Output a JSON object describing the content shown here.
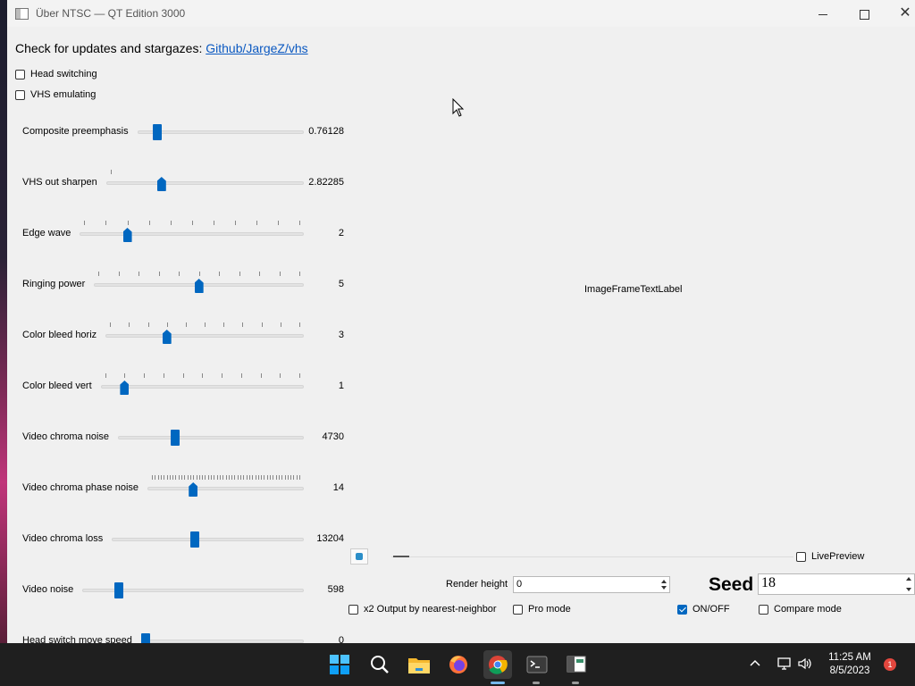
{
  "window": {
    "title": "Über NTSC — QT Edition 3000",
    "controls": {
      "minimize": "minimize",
      "maximize": "maximize",
      "close": "✕"
    }
  },
  "updates": {
    "text": "Check for updates and stargazes: ",
    "link": "Github/JargeZ/vhs"
  },
  "options": {
    "head_switching": {
      "label": "Head switching",
      "checked": false
    },
    "vhs_emulating": {
      "label": "VHS emulating",
      "checked": false
    }
  },
  "sliders": [
    {
      "label": "Composite preemphasis",
      "value": "0.76128",
      "fraction": 0.1,
      "ticks": 0,
      "pointed": false
    },
    {
      "label": "VHS out sharpen",
      "value": "2.82285",
      "fraction": 0.27,
      "ticks": 1,
      "pointed": true
    },
    {
      "label": "Edge wave",
      "value": "2",
      "fraction": 0.2,
      "ticks": 11,
      "pointed": true
    },
    {
      "label": "Ringing power",
      "value": "5",
      "fraction": 0.5,
      "ticks": 11,
      "pointed": true
    },
    {
      "label": "Color bleed horiz",
      "value": "3",
      "fraction": 0.3,
      "ticks": 11,
      "pointed": true
    },
    {
      "label": "Color bleed vert",
      "value": "1",
      "fraction": 0.1,
      "ticks": 11,
      "pointed": true
    },
    {
      "label": "Video chroma noise",
      "value": "4730",
      "fraction": 0.3,
      "ticks": 0,
      "pointed": false
    },
    {
      "label": "Video chroma phase noise",
      "value": "14",
      "fraction": 0.28,
      "ticks": 51,
      "pointed": true
    },
    {
      "label": "Video chroma loss",
      "value": "13204",
      "fraction": 0.43,
      "ticks": 0,
      "pointed": false
    },
    {
      "label": "Video noise",
      "value": "598",
      "fraction": 0.15,
      "ticks": 0,
      "pointed": false
    },
    {
      "label": "Head switch move speed",
      "value": "0",
      "fraction": 0.0,
      "ticks": 0,
      "pointed": false
    }
  ],
  "image_frame": {
    "label": "ImageFrameTextLabel"
  },
  "preview": {
    "live_preview": {
      "label": "LivePreview",
      "checked": false
    },
    "position": 0.0
  },
  "render": {
    "render_height_label": "Render height",
    "render_height_value": "0",
    "seed_label": "Seed",
    "seed_value": "18"
  },
  "bottom_options": {
    "x2_output": {
      "label": "x2 Output by nearest-neighbor",
      "checked": false
    },
    "pro_mode": {
      "label": "Pro mode",
      "checked": false
    },
    "on_off": {
      "label": "ON/OFF",
      "checked": true
    },
    "compare_mode": {
      "label": "Compare mode",
      "checked": false
    }
  },
  "taskbar": {
    "apps": [
      "start-icon",
      "search-icon",
      "file-explorer-icon",
      "firefox-icon",
      "chrome-icon",
      "terminal-icon",
      "app-window-icon"
    ],
    "clock_time": "11:25 AM",
    "clock_date": "8/5/2023",
    "notifications": "1"
  },
  "colors": {
    "accent": "#0067c0",
    "link": "#0b59c1",
    "taskbar": "#1f1f1f"
  }
}
